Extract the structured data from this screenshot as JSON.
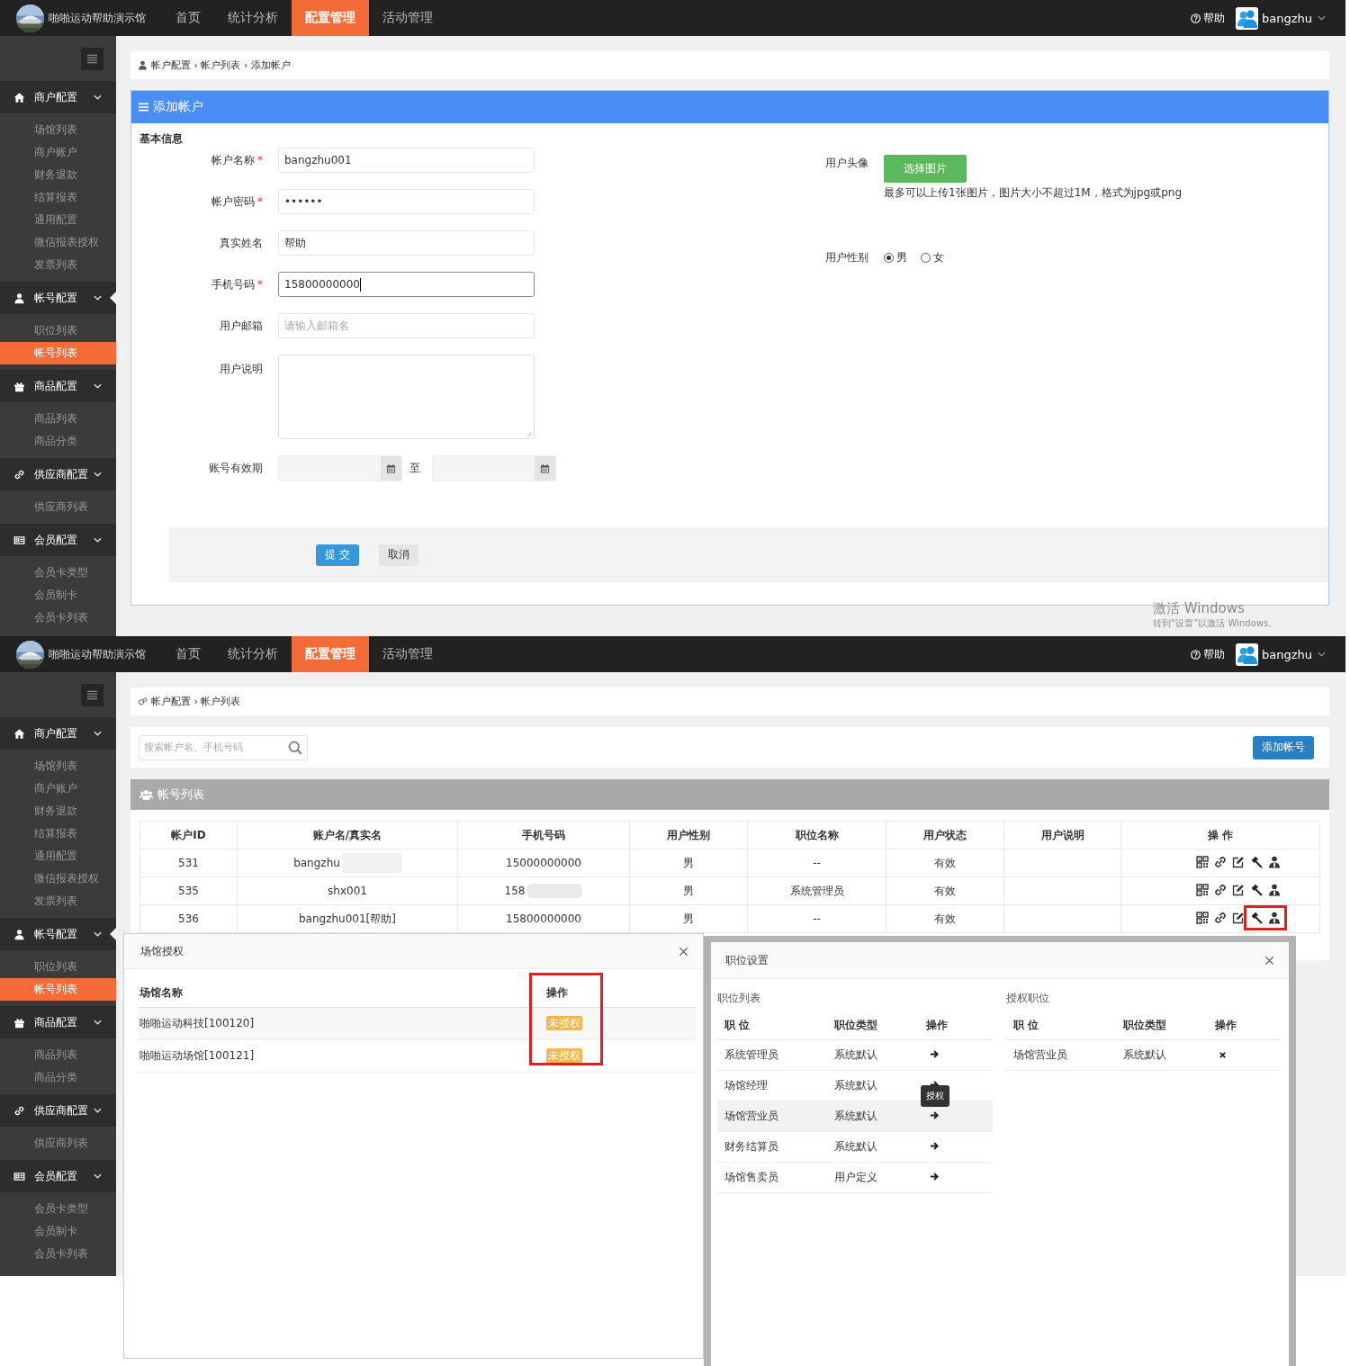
{
  "screens": [
    {
      "kind": "add_account",
      "header": {
        "brand": "啪啪运动帮助演示馆",
        "nav": [
          {
            "label": "首页",
            "selected": false
          },
          {
            "label": "统计分析",
            "selected": false
          },
          {
            "label": "配置管理",
            "selected": true
          },
          {
            "label": "活动管理",
            "selected": false
          }
        ],
        "help": "帮助",
        "user": "bangzhu"
      },
      "sidebar": [
        {
          "label": "商户配置",
          "selected": false,
          "items": [
            {
              "label": "场馆列表",
              "selected": false
            },
            {
              "label": "商户账户",
              "selected": false
            },
            {
              "label": "财务退款",
              "selected": false
            },
            {
              "label": "结算报表",
              "selected": false
            },
            {
              "label": "通用配置",
              "selected": false
            },
            {
              "label": "微信报表授权",
              "selected": false
            },
            {
              "label": "发票列表",
              "selected": false
            }
          ]
        },
        {
          "label": "帐号配置",
          "selected": true,
          "items": [
            {
              "label": "职位列表",
              "selected": false
            },
            {
              "label": "帐号列表",
              "selected": true
            }
          ]
        },
        {
          "label": "商品配置",
          "selected": false,
          "items": [
            {
              "label": "商品列表",
              "selected": false
            },
            {
              "label": "商品分类",
              "selected": false
            }
          ]
        },
        {
          "label": "供应商配置",
          "selected": false,
          "items": [
            {
              "label": "供应商列表",
              "selected": false
            }
          ]
        },
        {
          "label": "会员配置",
          "selected": false,
          "items": [
            {
              "label": "会员卡类型",
              "selected": false
            },
            {
              "label": "会员制卡",
              "selected": false
            },
            {
              "label": "会员卡列表",
              "selected": false
            }
          ]
        }
      ],
      "breadcrumb": "帐户配置 › 帐户列表 › 添加帐户",
      "form": {
        "title": "添加帐户",
        "section": "基本信息",
        "fields": [
          {
            "kind": "text",
            "label": "帐户名称",
            "required_mark": "*",
            "value": "bangzhu001",
            "focused": false
          },
          {
            "kind": "text",
            "label": "帐户密码",
            "required_mark": "*",
            "value": "••••••",
            "focused": false
          },
          {
            "kind": "text",
            "label": "真实姓名",
            "value": "帮助",
            "focused": false
          },
          {
            "kind": "text",
            "label": "手机号码",
            "required_mark": "*",
            "value": "15800000000",
            "focused": true
          },
          {
            "kind": "text",
            "label": "用户邮箱",
            "placeholder": "请输入邮箱名",
            "focused": false
          },
          {
            "kind": "textarea",
            "label": "用户说明"
          },
          {
            "kind": "daterange",
            "label": "账号有效期",
            "separator": "至"
          }
        ],
        "avatar": {
          "label": "用户头像",
          "button": "选择图片",
          "hint": "最多可以上传1张图片，图片大小不超过1M，格式为jpg或png"
        },
        "gender": {
          "label": "用户性别",
          "options": [
            {
              "label": "男",
              "selected": true
            },
            {
              "label": "女",
              "selected": false
            }
          ]
        },
        "actions": [
          {
            "label": "提 交",
            "kind": "primary"
          },
          {
            "label": "取消",
            "kind": "default"
          }
        ]
      },
      "os_notice": {
        "title": "激活 Windows",
        "subtitle": "转到“设置”以激活 Windows。"
      }
    },
    {
      "kind": "account_list",
      "header": {
        "brand": "啪啪运动帮助演示馆",
        "nav": [
          {
            "label": "首页",
            "selected": false
          },
          {
            "label": "统计分析",
            "selected": false
          },
          {
            "label": "配置管理",
            "selected": true
          },
          {
            "label": "活动管理",
            "selected": false
          }
        ],
        "help": "帮助",
        "user": "bangzhu"
      },
      "sidebar": [
        {
          "label": "商户配置",
          "selected": false,
          "items": [
            {
              "label": "场馆列表",
              "selected": false
            },
            {
              "label": "商户账户",
              "selected": false
            },
            {
              "label": "财务退款",
              "selected": false
            },
            {
              "label": "结算报表",
              "selected": false
            },
            {
              "label": "通用配置",
              "selected": false
            },
            {
              "label": "微信报表授权",
              "selected": false
            },
            {
              "label": "发票列表",
              "selected": false
            }
          ]
        },
        {
          "label": "帐号配置",
          "selected": true,
          "items": [
            {
              "label": "职位列表",
              "selected": false
            },
            {
              "label": "帐号列表",
              "selected": true
            }
          ]
        },
        {
          "label": "商品配置",
          "selected": false,
          "items": [
            {
              "label": "商品列表",
              "selected": false
            },
            {
              "label": "商品分类",
              "selected": false
            }
          ]
        },
        {
          "label": "供应商配置",
          "selected": false,
          "items": [
            {
              "label": "供应商列表",
              "selected": false
            }
          ]
        },
        {
          "label": "会员配置",
          "selected": false,
          "items": [
            {
              "label": "会员卡类型",
              "selected": false
            },
            {
              "label": "会员制卡",
              "selected": false
            },
            {
              "label": "会员卡列表",
              "selected": false
            }
          ]
        }
      ],
      "breadcrumb": "帐户配置 › 帐户列表",
      "search": {
        "placeholder": "搜索帐户名、手机号码"
      },
      "add_button": "添加帐号",
      "list": {
        "title": "帐号列表",
        "columns": [
          "帐户ID",
          "账户名/真实名",
          "手机号码",
          "用户性别",
          "职位名称",
          "用户状态",
          "用户说明",
          "操 作"
        ],
        "rows": [
          {
            "id": "531",
            "name": "bangzhu",
            "name_redacted": true,
            "phone": "15000000000",
            "phone_redacted": false,
            "gender": "男",
            "position": "--",
            "status": "有效",
            "highlighted": false
          },
          {
            "id": "535",
            "name": "shx001",
            "name_redacted": false,
            "phone": "158",
            "phone_redacted": true,
            "gender": "男",
            "position": "系统管理员",
            "status": "有效",
            "highlighted": false
          },
          {
            "id": "536",
            "name": "bangzhu001[帮助]",
            "name_redacted": false,
            "phone": "15800000000",
            "phone_redacted": false,
            "gender": "男",
            "position": "--",
            "status": "有效",
            "highlighted": true
          }
        ]
      },
      "venue_modal": {
        "title": "场馆授权",
        "columns": [
          "场馆名称",
          "操作"
        ],
        "highlighted": true,
        "rows": [
          {
            "name": "啪啪运动科技[100120]",
            "status": "未授权"
          },
          {
            "name": "啪啪运动场馆[100121]",
            "status": "未授权"
          }
        ]
      },
      "position_modal": {
        "title": "职位设置",
        "available": {
          "title": "职位列表",
          "columns": [
            "职 位",
            "职位类型",
            "操作"
          ],
          "rows": [
            {
              "name": "系统管理员",
              "type": "系统默认",
              "hovered": false
            },
            {
              "name": "场馆经理",
              "type": "系统默认",
              "hovered": false
            },
            {
              "name": "场馆营业员",
              "type": "系统默认",
              "hovered": true,
              "tooltip": "授权"
            },
            {
              "name": "财务结算员",
              "type": "系统默认",
              "hovered": false
            },
            {
              "name": "场馆售卖员",
              "type": "用户定义",
              "hovered": false
            }
          ]
        },
        "granted": {
          "title": "授权职位",
          "columns": [
            "职 位",
            "职位类型",
            "操作"
          ],
          "rows": [
            {
              "name": "场馆营业员",
              "type": "系统默认"
            }
          ]
        }
      }
    }
  ]
}
